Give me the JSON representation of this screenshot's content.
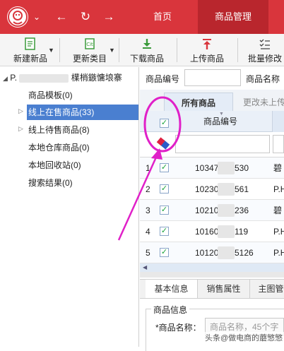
{
  "nav": {
    "tabs": [
      {
        "label": "首页"
      },
      {
        "label": "商品管理"
      }
    ]
  },
  "toolbar": {
    "items": [
      {
        "label": "新建新品"
      },
      {
        "label": "更新类目"
      },
      {
        "label": "下载商品"
      },
      {
        "label": "上传商品"
      },
      {
        "label": "批量修改"
      }
    ]
  },
  "tree": {
    "root_prefix": "P.",
    "root_suffix": "檏梢鏃慵埌寨",
    "items": [
      {
        "label": "商品模板(0)"
      },
      {
        "label": "线上在售商品(33)"
      },
      {
        "label": "线上待售商品(8)"
      },
      {
        "label": "本地仓库商品(0)"
      },
      {
        "label": "本地回收站(0)"
      },
      {
        "label": "搜索结果(0)"
      }
    ]
  },
  "search": {
    "code_label": "商品编号",
    "name_label": "商品名称"
  },
  "grid": {
    "tabs": [
      {
        "label": "所有商品"
      },
      {
        "label": "更改未上传"
      }
    ],
    "header_code": "商品编号",
    "rows": [
      {
        "index": "1",
        "code_a": "10347",
        "code_b": "530",
        "name": "碧"
      },
      {
        "index": "2",
        "code_a": "10230",
        "code_b": "561",
        "name": "P.H"
      },
      {
        "index": "3",
        "code_a": "10210",
        "code_b": "236",
        "name": "碧"
      },
      {
        "index": "4",
        "code_a": "10160",
        "code_b": "119",
        "name": "P.H"
      },
      {
        "index": "5",
        "code_a": "10120",
        "code_b": "5126",
        "name": "P.H"
      }
    ]
  },
  "detail": {
    "tabs": [
      {
        "label": "基本信息"
      },
      {
        "label": "销售属性"
      },
      {
        "label": "主图管"
      }
    ],
    "section_title": "商品信息",
    "name_label": "*商品名称：",
    "name_placeholder": "商品名称，45个字",
    "watermark": "头条@做电商的蘑慜慜"
  },
  "colors": {
    "brand_red": "#d9353c",
    "selection_blue": "#4a7fd0",
    "annotation_magenta": "#e020c8"
  }
}
